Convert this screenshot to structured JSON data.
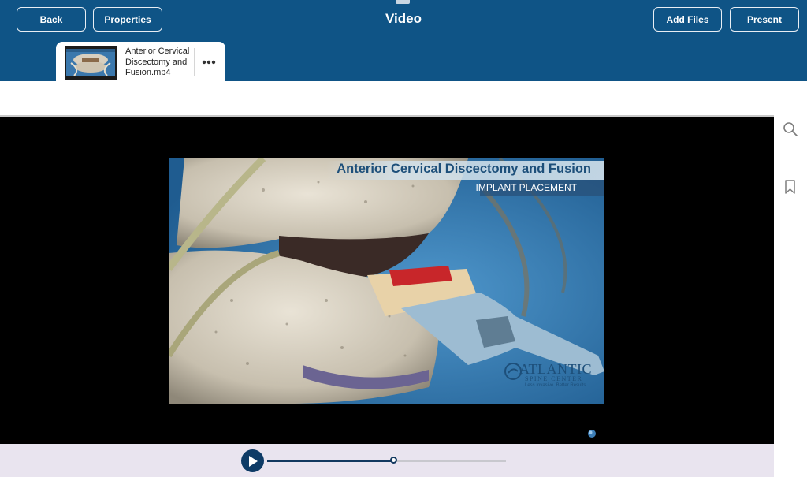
{
  "header": {
    "title": "Video",
    "back_label": "Back",
    "properties_label": "Properties",
    "add_files_label": "Add Files",
    "present_label": "Present",
    "background_color": "#0f5486"
  },
  "file_tab": {
    "name": "Anterior Cervical Discectomy and Fusion.mp4",
    "more_icon": "more-horizontal-icon"
  },
  "video": {
    "title_overlay": "Anterior Cervical Discectomy and Fusion",
    "subtitle_overlay": "IMPLANT PLACEMENT",
    "logo_name": "ATLANTIC",
    "logo_subname": "SPINE CENTER",
    "logo_tagline": "Less Invasive. Better Results."
  },
  "player": {
    "play_icon": "play-icon",
    "progress": 0.53,
    "accent_color": "#0e3b66"
  },
  "side_rail": {
    "search_icon": "search-icon",
    "bookmark_icon": "bookmark-icon"
  }
}
